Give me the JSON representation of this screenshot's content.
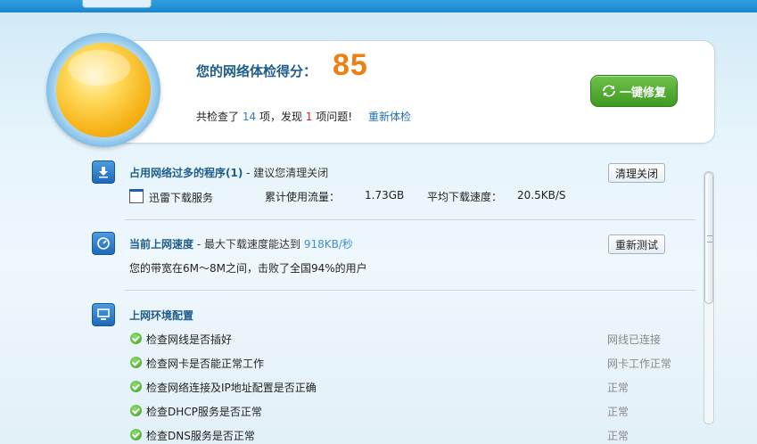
{
  "header": {
    "score_label": "您的网络体检得分：",
    "score": "85",
    "summary_prefix": "共检查了",
    "checked_count": "14",
    "summary_mid": "项，发现",
    "issue_count": "1",
    "summary_suffix": "项问题!",
    "recheck_link": "重新体检",
    "fix_button": "一键修复"
  },
  "sections": {
    "programs": {
      "title": "占用网络过多的程序(1)",
      "subtitle": " - 建议您清理关闭",
      "button": "清理关闭",
      "item_name": "迅雷下载服务",
      "usage_label": "累计使用流量：",
      "usage_value": "1.73GB",
      "speed_label": "平均下载速度：",
      "speed_value": "20.5KB/S"
    },
    "speed": {
      "title": "当前上网速度",
      "subtitle_prefix": " - 最大下载速度能达到",
      "subtitle_value": "918KB/秒",
      "button": "重新测试",
      "detail": "您的带宽在6M～8M之间，击败了全国94%的用户"
    },
    "env": {
      "title": "上网环境配置",
      "items": [
        {
          "label": "检查网线是否插好",
          "status": "网线已连接"
        },
        {
          "label": "检查网卡是否能正常工作",
          "status": "网卡工作正常"
        },
        {
          "label": "检查网络连接及IP地址配置是否正确",
          "status": "正常"
        },
        {
          "label": "检查DHCP服务是否正常",
          "status": "正常"
        },
        {
          "label": "检查DNS服务是否正常",
          "status": "正常"
        }
      ]
    }
  },
  "colors": {
    "score": "#f07f12",
    "accent": "#1e5d8c",
    "fix_button": "#4fae2e"
  }
}
